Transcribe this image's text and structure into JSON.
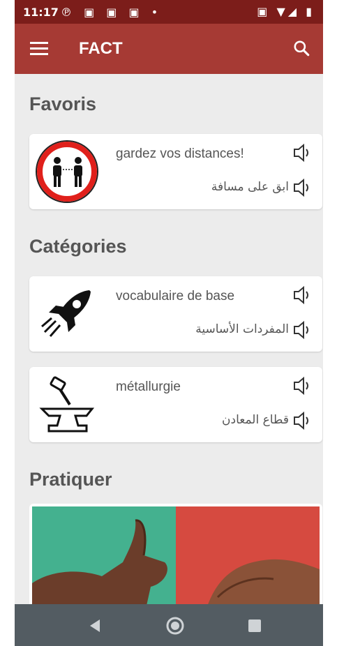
{
  "status_bar": {
    "time": "11:17",
    "left_icons": [
      "pinterest-icon",
      "sim-icon",
      "image-icon",
      "sim-icon",
      "dot-icon"
    ],
    "right_icons": [
      "nfc-icon",
      "wifi-icon",
      "signal-icon",
      "battery-icon"
    ]
  },
  "app_bar": {
    "title": "FACT",
    "color": "#a63a34",
    "status_color": "#7c1d1a"
  },
  "sections": {
    "favorites_title": "Favoris",
    "categories_title": "Catégories",
    "practice_title": "Pratiquer"
  },
  "favorites": [
    {
      "fr": "gardez vos distances!",
      "ar": "ابق على مسافة",
      "icon": "keep-distance-sign-icon"
    }
  ],
  "categories": [
    {
      "fr": "vocabulaire de base",
      "ar": "المفردات الأساسية",
      "icon": "rocket-icon"
    },
    {
      "fr": "métallurgie",
      "ar": "قطاع المعادن",
      "icon": "anvil-hammer-icon"
    }
  ],
  "practice": {
    "left_color": "#44b18f",
    "right_color": "#d64a40"
  },
  "nav": [
    "back-icon",
    "home-icon",
    "recents-icon"
  ]
}
